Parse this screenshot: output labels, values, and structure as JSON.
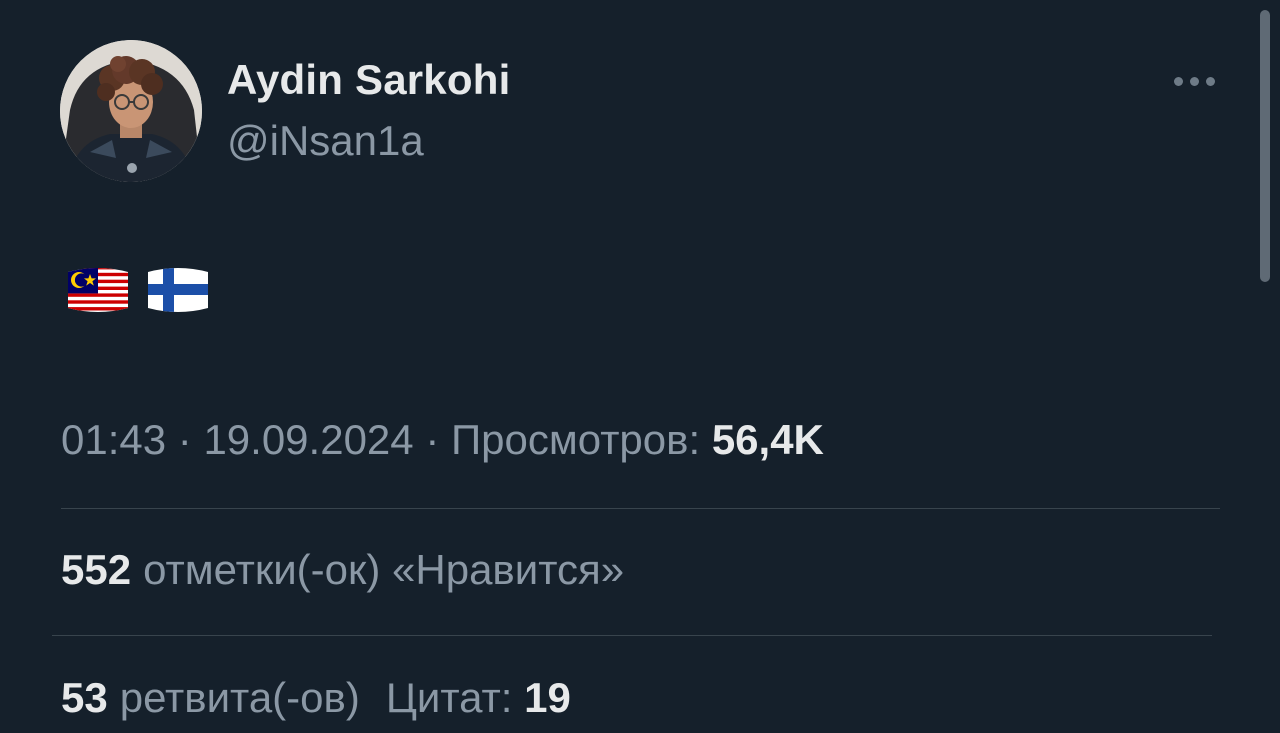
{
  "tweet": {
    "author": {
      "display_name": "Aydin Sarkohi",
      "handle": "@iNsan1a",
      "avatar_icon": "profile-photo"
    },
    "more_icon": "more-horizontal-icon",
    "body": {
      "flags": [
        "malaysia-flag",
        "finland-flag"
      ]
    },
    "meta": {
      "time": "01:43",
      "separator": " · ",
      "date": "19.09.2024",
      "views_label": "Просмотров:",
      "views_count": "56,4K"
    },
    "stats": {
      "likes_count": "552",
      "likes_label": "отметки(-ок) «Нравится»",
      "retweets_count": "53",
      "retweets_label": "ретвита(-ов)",
      "quotes_label": "Цитат:",
      "quotes_count": "19"
    }
  },
  "colors": {
    "background": "#15202b",
    "primary_text": "#e7e9ea",
    "secondary_text": "#8b98a5",
    "divider": "#38444d"
  }
}
